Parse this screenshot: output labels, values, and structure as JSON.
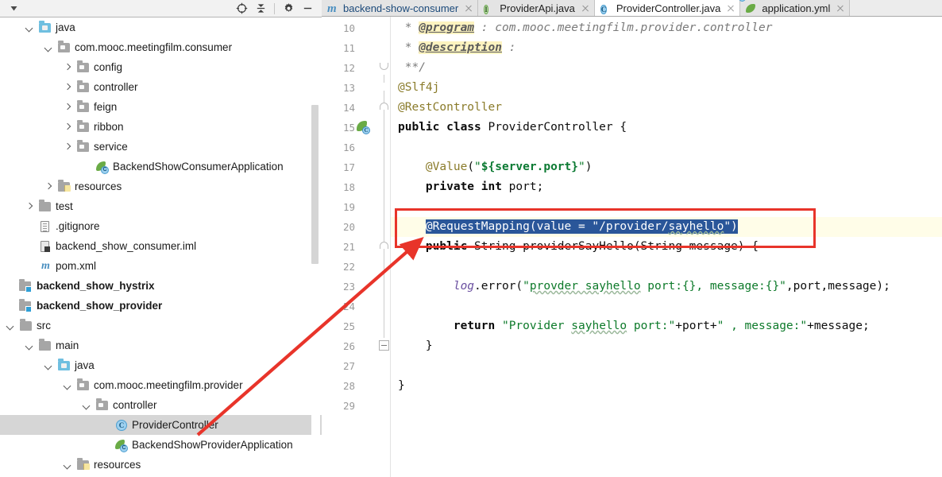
{
  "app": {
    "kind": "ide-screenshot",
    "accent_red": "#e8342a",
    "selection_blue": "#2a5699",
    "current_line_yellow": "#fffde8",
    "tree_selection_gray": "#d6d6d6"
  },
  "project_toolbar": {
    "left_dropdown_label": "▼",
    "buttons": [
      {
        "name": "select-opened-file",
        "icon": "target-icon",
        "tooltip": "Select Opened File"
      },
      {
        "name": "collapse-all",
        "icon": "collapse-all-icon",
        "tooltip": "Collapse All"
      },
      {
        "name": "settings",
        "icon": "gear-icon",
        "tooltip": "Settings"
      },
      {
        "name": "hide",
        "icon": "minimize-icon",
        "tooltip": "Hide"
      }
    ]
  },
  "project_tree": {
    "items": [
      {
        "label": "java",
        "icon": "folder-source-blue",
        "indent": 2,
        "toggle": "down",
        "bold": false,
        "selected": false
      },
      {
        "label": "com.mooc.meetingfilm.consumer",
        "icon": "folder-package",
        "indent": 3,
        "toggle": "down",
        "bold": false,
        "selected": false
      },
      {
        "label": "config",
        "icon": "folder-package",
        "indent": 4,
        "toggle": "right",
        "bold": false,
        "selected": false
      },
      {
        "label": "controller",
        "icon": "folder-package",
        "indent": 4,
        "toggle": "right",
        "bold": false,
        "selected": false
      },
      {
        "label": "feign",
        "icon": "folder-package",
        "indent": 4,
        "toggle": "right",
        "bold": false,
        "selected": false
      },
      {
        "label": "ribbon",
        "icon": "folder-package",
        "indent": 4,
        "toggle": "right",
        "bold": false,
        "selected": false
      },
      {
        "label": "service",
        "icon": "folder-package",
        "indent": 4,
        "toggle": "right",
        "bold": false,
        "selected": false
      },
      {
        "label": "BackendShowConsumerApplication",
        "icon": "spring-boot-class",
        "indent": 5,
        "toggle": "none",
        "bold": false,
        "selected": false
      },
      {
        "label": "resources",
        "icon": "folder-resources",
        "indent": 3,
        "toggle": "right",
        "bold": false,
        "selected": false
      },
      {
        "label": "test",
        "icon": "folder-gray",
        "indent": 2,
        "toggle": "right",
        "bold": false,
        "selected": false
      },
      {
        "label": ".gitignore",
        "icon": "file-text",
        "indent": 2,
        "toggle": "none",
        "bold": false,
        "selected": false
      },
      {
        "label": "backend_show_consumer.iml",
        "icon": "file-iml",
        "indent": 2,
        "toggle": "none",
        "bold": false,
        "selected": false
      },
      {
        "label": "pom.xml",
        "icon": "file-maven",
        "indent": 2,
        "toggle": "none",
        "bold": false,
        "selected": false
      },
      {
        "label": "backend_show_hystrix",
        "icon": "module",
        "indent": 1,
        "toggle": "none",
        "bold": true,
        "selected": false
      },
      {
        "label": "backend_show_provider",
        "icon": "module",
        "indent": 1,
        "toggle": "none",
        "bold": true,
        "selected": false
      },
      {
        "label": "src",
        "icon": "folder-gray",
        "indent": 1,
        "toggle": "down",
        "bold": false,
        "selected": false
      },
      {
        "label": "main",
        "icon": "folder-gray",
        "indent": 2,
        "toggle": "down",
        "bold": false,
        "selected": false
      },
      {
        "label": "java",
        "icon": "folder-source-blue",
        "indent": 3,
        "toggle": "down",
        "bold": false,
        "selected": false
      },
      {
        "label": "com.mooc.meetingfilm.provider",
        "icon": "folder-package",
        "indent": 4,
        "toggle": "down",
        "bold": false,
        "selected": false
      },
      {
        "label": "controller",
        "icon": "folder-package",
        "indent": 5,
        "toggle": "down",
        "bold": false,
        "selected": false
      },
      {
        "label": "ProviderController",
        "icon": "java-class",
        "indent": 6,
        "toggle": "none",
        "bold": false,
        "selected": true
      },
      {
        "label": "BackendShowProviderApplication",
        "icon": "spring-boot-class",
        "indent": 6,
        "toggle": "none",
        "bold": false,
        "selected": false
      },
      {
        "label": "resources",
        "icon": "folder-resources",
        "indent": 4,
        "toggle": "down",
        "bold": false,
        "selected": false
      }
    ]
  },
  "editor_tabs": [
    {
      "label": "backend-show-consumer",
      "icon": "maven-icon",
      "active": false,
      "closable": true
    },
    {
      "label": "ProviderApi.java",
      "icon": "interface-icon",
      "active": false,
      "closable": true
    },
    {
      "label": "ProviderController.java",
      "icon": "class-icon",
      "active": true,
      "closable": true
    },
    {
      "label": "application.yml",
      "icon": "spring-yaml-icon",
      "active": false,
      "closable": true
    }
  ],
  "editor": {
    "file": "ProviderController.java",
    "first_visible_line": 10,
    "last_visible_line": 29,
    "caret_line": 20,
    "selected_text": "@RequestMapping(value = \"/provider/sayhello\")",
    "lines": [
      {
        "n": 10,
        "text": " * @program : com.mooc.meetingfilm.provider.controller"
      },
      {
        "n": 11,
        "text": " * @description : "
      },
      {
        "n": 12,
        "text": " **/"
      },
      {
        "n": 13,
        "text": "@Slf4j"
      },
      {
        "n": 14,
        "text": "@RestController"
      },
      {
        "n": 15,
        "text": "public class ProviderController {"
      },
      {
        "n": 16,
        "text": ""
      },
      {
        "n": 17,
        "text": "    @Value(\"${server.port}\")"
      },
      {
        "n": 18,
        "text": "    private int port;"
      },
      {
        "n": 19,
        "text": ""
      },
      {
        "n": 20,
        "text": "    @RequestMapping(value = \"/provider/sayhello\")"
      },
      {
        "n": 21,
        "text": "    public String providerSayHello(String message) {"
      },
      {
        "n": 22,
        "text": ""
      },
      {
        "n": 23,
        "text": "        log.error(\"provder sayhello port:{}, message:{}\",port,message);"
      },
      {
        "n": 24,
        "text": ""
      },
      {
        "n": 25,
        "text": "        return \"Provider sayhello port:\"+port+\" , message:\"+message;"
      },
      {
        "n": 26,
        "text": "    }"
      },
      {
        "n": 27,
        "text": ""
      },
      {
        "n": 28,
        "text": "}"
      },
      {
        "n": 29,
        "text": ""
      }
    ],
    "gutter_icons": [
      {
        "line": 15,
        "icon": "spring-bean-icon"
      }
    ]
  },
  "annotations": {
    "red_box": {
      "label": "highlight-rectangle-around-request-mapping",
      "color": "#e8342a"
    },
    "red_arrow": {
      "label": "arrow-from-provider-controller-to-request-mapping",
      "color": "#e8342a"
    }
  }
}
